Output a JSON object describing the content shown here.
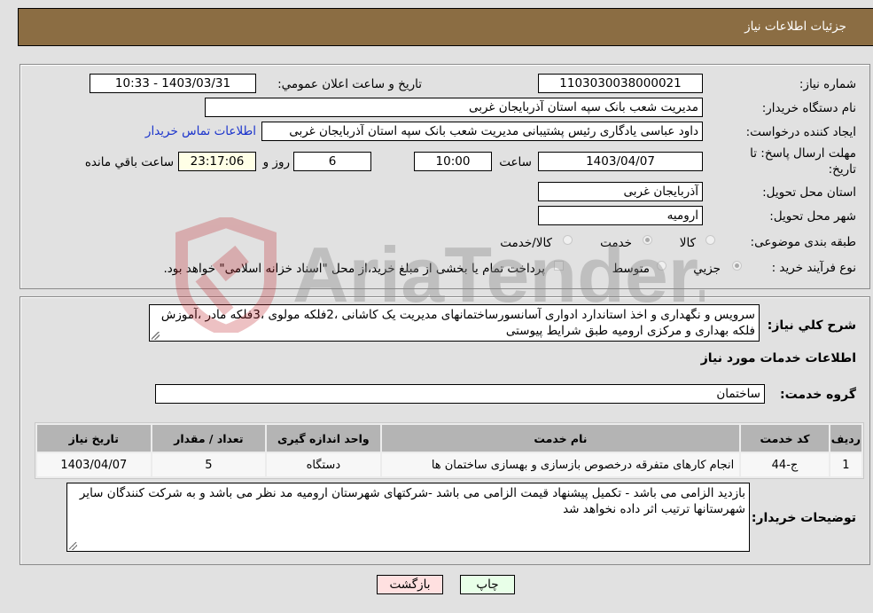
{
  "header": {
    "title": "جزئیات اطلاعات نیاز"
  },
  "fields": {
    "need_number": {
      "label": "شماره نیاز:",
      "value": "1103030038000021"
    },
    "announce_datetime": {
      "label": "تاریخ و ساعت اعلان عمومي:",
      "value": "1403/03/31 - 10:33"
    },
    "buyer_org": {
      "label": "نام دستگاه خریدار:",
      "value": "مدیریت شعب بانک سپه استان آذربایجان غربی"
    },
    "requester": {
      "label": "ایجاد کننده درخواست:",
      "value": "داود عباسی یادگاری رئیس پشتیبانی مدیریت شعب بانک سپه استان آذربایجان غربی",
      "link": "اطلاعات تماس خریدار"
    },
    "deadline": {
      "label_line1": "مهلت ارسال پاسخ: تا",
      "label_line2": "تاریخ:",
      "date": "1403/04/07",
      "time_label": "ساعت",
      "time": "10:00",
      "days": "6",
      "days_label": "روز و",
      "remaining": "23:17:06",
      "remaining_label": "ساعت باقي مانده"
    },
    "delivery_province": {
      "label": "استان محل تحویل:",
      "value": "آذربایجان غربی"
    },
    "delivery_city": {
      "label": "شهر محل تحویل:",
      "value": "ارومیه"
    },
    "category": {
      "label": "طبقه بندی موضوعی:",
      "options": [
        {
          "label": "کالا",
          "checked": false
        },
        {
          "label": "خدمت",
          "checked": true
        },
        {
          "label": "کالا/خدمت",
          "checked": false
        }
      ]
    },
    "purchase_type": {
      "label": "نوع فرآیند خرید :",
      "options": [
        {
          "label": "جزيي",
          "checked": true
        },
        {
          "label": "متوسط",
          "checked": false
        }
      ],
      "treasury_checkbox_label": "پرداخت تمام یا بخشی از مبلغ خرید،از محل \"اسناد خزانه اسلامی\" خواهد بود.",
      "treasury_checked": false
    }
  },
  "description": {
    "label": "شرح کلي نیاز:",
    "value": "سرویس و نگهداری  و اخذ استاندارد ادواری آسانسورساختمانهای مدیریت یک کاشانی ،2فلکه مولوی ،3فلکه مادر ،آموزش فلکه بهداری و مرکزی ارومیه طبق شرایط پیوستی"
  },
  "services_section": {
    "title": "اطلاعات خدمات مورد نیاز",
    "group_label": "گروه خدمت:",
    "group_value": "ساختمان",
    "table": {
      "headers": [
        "ردیف",
        "کد خدمت",
        "نام خدمت",
        "واحد اندازه گیری",
        "تعداد / مقدار",
        "تاریخ نیاز"
      ],
      "rows": [
        [
          "1",
          "ج-44",
          "انجام کارهای متفرقه درخصوص بازسازی و بهسازی ساختمان ها",
          "دستگاه",
          "5",
          "1403/04/07"
        ]
      ]
    }
  },
  "buyer_notes": {
    "label": "توضیحات خریدار:",
    "value": "بازدید الزامی می باشد - تکمیل پیشنهاد قیمت الزامی می باشد -شرکتهای شهرستان ارومیه مد نظر می باشد و به شرکت کنندگان سایر شهرستانها ترتیب اثر داده نخواهد شد"
  },
  "buttons": {
    "print": "چاپ",
    "back": "بازگشت"
  },
  "watermark": {
    "text": "AriaTender.neT"
  },
  "colors": {
    "header_bg": "#8b6d43",
    "link": "#1a33cc",
    "print_bg": "#e8ffe8",
    "back_bg": "#ffe0e0"
  }
}
